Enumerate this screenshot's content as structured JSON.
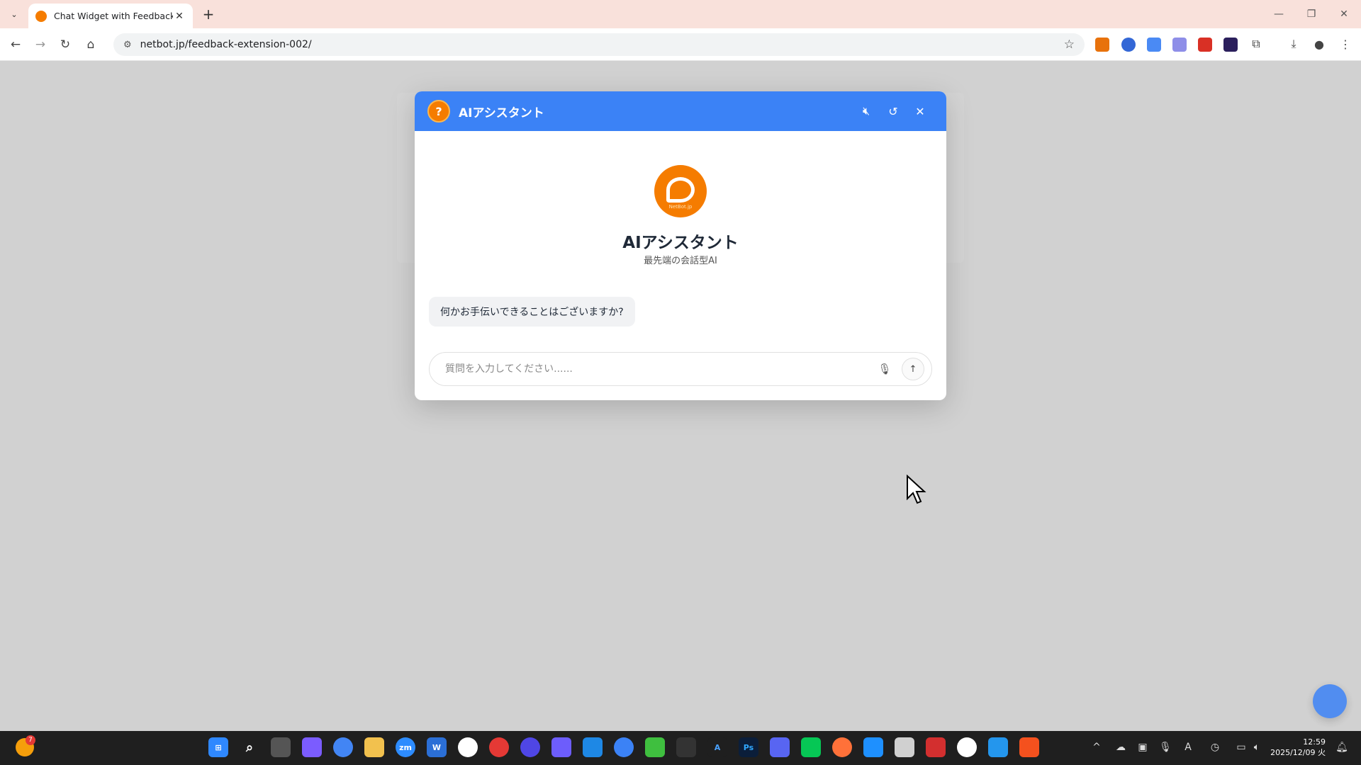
{
  "browser": {
    "tab_title": "Chat Widget with Feedback",
    "url": "netbot.jp/feedback-extension-002/"
  },
  "widget": {
    "header_title": "AIアシスタント",
    "avatar_label": "NetBot.jp",
    "bot_name": "AIアシスタント",
    "bot_tagline": "最先端の会話型AI",
    "greeting": "何かお手伝いできることはございますか?",
    "input_placeholder": "質問を入力してください......",
    "accent_color": "#3b82f6",
    "brand_color": "#f57c00"
  },
  "taskbar": {
    "widget_badge": "7",
    "time": "12:59",
    "date": "2025/12/09 火"
  }
}
